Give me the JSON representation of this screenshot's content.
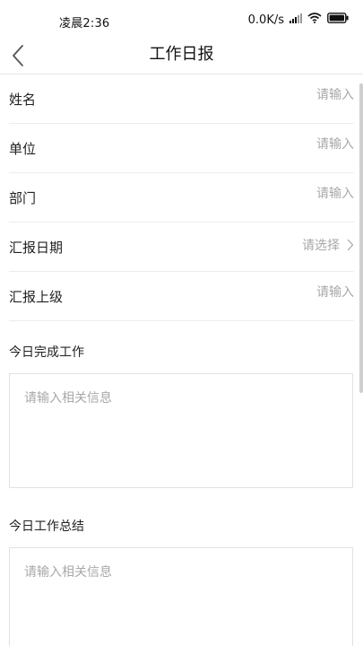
{
  "status_bar": {
    "time": "凌晨2:36",
    "network_speed": "0.0K/s"
  },
  "header": {
    "title": "工作日报",
    "back_icon": "chevron-left-icon"
  },
  "form": {
    "rows": [
      {
        "label": "姓名",
        "placeholder": "请输入"
      },
      {
        "label": "单位",
        "placeholder": "请输入"
      },
      {
        "label": "部门",
        "placeholder": "请输入"
      },
      {
        "label": "汇报日期",
        "picker_text": "请选择"
      },
      {
        "label": "汇报上级",
        "placeholder": "请输入"
      }
    ],
    "sections": [
      {
        "title": "今日完成工作",
        "placeholder": "请输入相关信息"
      },
      {
        "title": "今日工作总结",
        "placeholder": "请输入相关信息"
      }
    ]
  },
  "colors": {
    "placeholder": "#a8a8a8",
    "divider": "#ececec",
    "text": "#222222"
  }
}
